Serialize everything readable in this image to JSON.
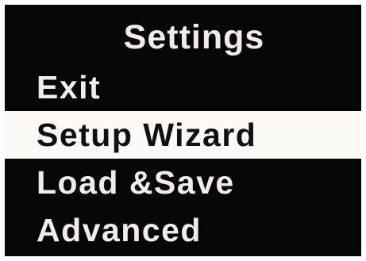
{
  "screen": {
    "title": "Settings"
  },
  "menu": {
    "selected_index": 1,
    "items": [
      {
        "label": "Exit"
      },
      {
        "label": "Setup Wizard"
      },
      {
        "label": "Load &Save"
      },
      {
        "label": "Advanced"
      }
    ]
  },
  "colors": {
    "background": "#060606",
    "text": "#f2ece8",
    "highlight_background": "#fbf9f6",
    "highlight_text": "#101010"
  }
}
